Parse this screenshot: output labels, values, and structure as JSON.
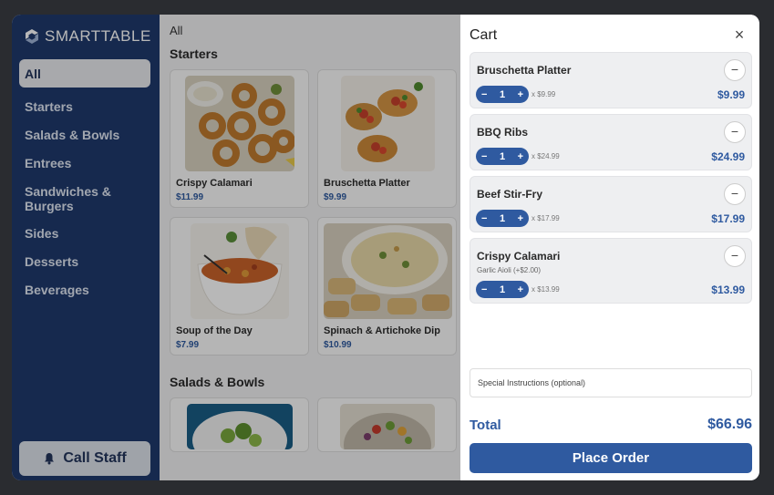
{
  "app": {
    "brand": "SMARTTABLE"
  },
  "sidebar": {
    "categories": [
      {
        "label": "All",
        "active": true
      },
      {
        "label": "Starters"
      },
      {
        "label": "Salads & Bowls"
      },
      {
        "label": "Entrees"
      },
      {
        "label": "Sandwiches & Burgers"
      },
      {
        "label": "Sides"
      },
      {
        "label": "Desserts"
      },
      {
        "label": "Beverages"
      }
    ],
    "call_staff_label": "Call Staff"
  },
  "menu": {
    "crumb": "All",
    "sections": [
      {
        "title": "Starters",
        "items": [
          {
            "name": "Crispy Calamari",
            "price": "$11.99"
          },
          {
            "name": "Bruschetta Platter",
            "price": "$9.99"
          },
          {
            "name": "Soup of the Day",
            "price": "$7.99"
          },
          {
            "name": "Spinach & Artichoke Dip",
            "price": "$10.99"
          }
        ]
      },
      {
        "title": "Salads & Bowls"
      }
    ]
  },
  "cart": {
    "title": "Cart",
    "close_icon": "×",
    "items": [
      {
        "name": "Bruschetta Platter",
        "modifier": "",
        "qty": "1",
        "unit": "x $9.99",
        "line_total": "$9.99"
      },
      {
        "name": "BBQ Ribs",
        "modifier": "",
        "qty": "1",
        "unit": "x $24.99",
        "line_total": "$24.99"
      },
      {
        "name": "Beef Stir-Fry",
        "modifier": "",
        "qty": "1",
        "unit": "x $17.99",
        "line_total": "$17.99"
      },
      {
        "name": "Crispy Calamari",
        "modifier": "Garlic Aioli (+$2.00)",
        "qty": "1",
        "unit": "x $13.99",
        "line_total": "$13.99"
      }
    ],
    "instructions_placeholder": "Special Instructions (optional)",
    "total_label": "Total",
    "total_value": "$66.96",
    "place_order_label": "Place Order"
  },
  "colors": {
    "accent": "#2f5aa0",
    "sidebar": "#1f3a6d"
  }
}
